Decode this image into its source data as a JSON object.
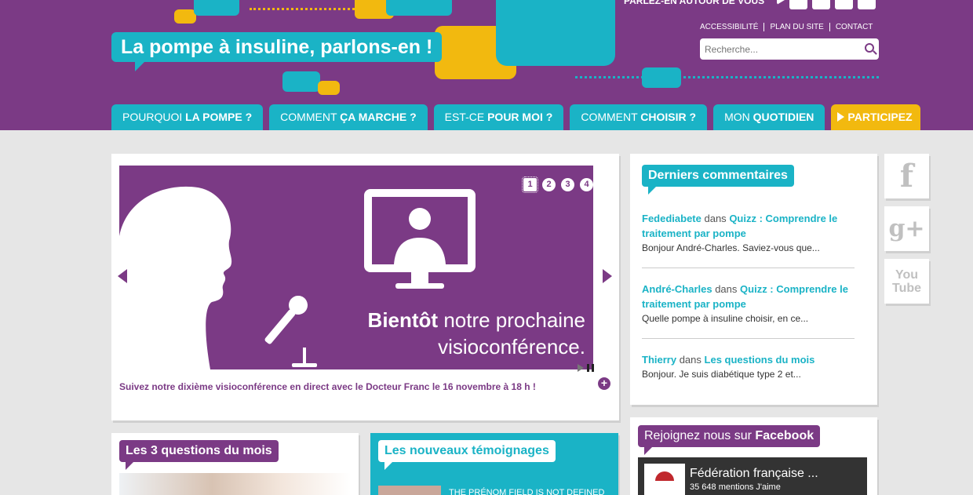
{
  "header": {
    "site_title": "La pompe à insuline, parlons-en !",
    "talk_label": "PARLEZ-EN AUTOUR DE VOUS",
    "social_top": [
      "play-icon",
      "facebook-icon",
      "twitter-icon",
      "mail-icon",
      "rss-icon"
    ],
    "top_links": [
      "ACCESSIBILITÉ",
      "PLAN DU SITE",
      "CONTACT"
    ],
    "search_placeholder": "Recherche..."
  },
  "nav": [
    {
      "pre": "POURQUOI ",
      "bold": "LA POMPE ?"
    },
    {
      "pre": "COMMENT ",
      "bold": "ÇA MARCHE ?"
    },
    {
      "pre": "EST-CE ",
      "bold": "POUR MOI ?"
    },
    {
      "pre": "COMMENT ",
      "bold": "CHOISIR ?"
    },
    {
      "pre": "MON ",
      "bold": "QUOTIDIEN"
    },
    {
      "pre": "",
      "bold": "PARTICIPEZ"
    }
  ],
  "slider": {
    "pager": [
      "1",
      "2",
      "3",
      "4"
    ],
    "caption_bold": "Bientôt",
    "caption_rest": " notre prochaine",
    "caption_line2": "visioconférence.",
    "description": "Suivez notre dixième visioconférence en direct avec le Docteur Franc le 16 novembre à 18 h !",
    "plus": "+"
  },
  "comments": {
    "title": "Derniers commentaires",
    "items": [
      {
        "author": "Fedediabete",
        "dans": "dans",
        "post": "Quizz : Comprendre le traitement par pompe",
        "excerpt": "Bonjour André-Charles. Saviez-vous que..."
      },
      {
        "author": "André-Charles",
        "dans": "dans",
        "post": "Quizz : Comprendre le traitement par pompe",
        "excerpt": "Quelle pompe à insuline choisir, en ce..."
      },
      {
        "author": "Thierry",
        "dans": "dans",
        "post": "Les questions du mois",
        "excerpt": "Bonjour. Je suis diabétique type 2 et..."
      }
    ]
  },
  "social_side": [
    {
      "icon": "facebook-icon",
      "glyph": "f"
    },
    {
      "icon": "google-plus-icon",
      "glyph": "g+"
    },
    {
      "icon": "youtube-icon",
      "glyph": "You Tube"
    }
  ],
  "facebook": {
    "title_pre": "Rejoignez nous sur ",
    "title_bold": "Facebook",
    "page_name": "Fédération française ...",
    "likes": "35 648 mentions J'aime"
  },
  "questions": {
    "title": "Les 3 questions du mois"
  },
  "temoignages": {
    "title": "Les nouveaux témoignages",
    "text": "THE PRÉNOM FIELD IS NOT DEFINED"
  }
}
